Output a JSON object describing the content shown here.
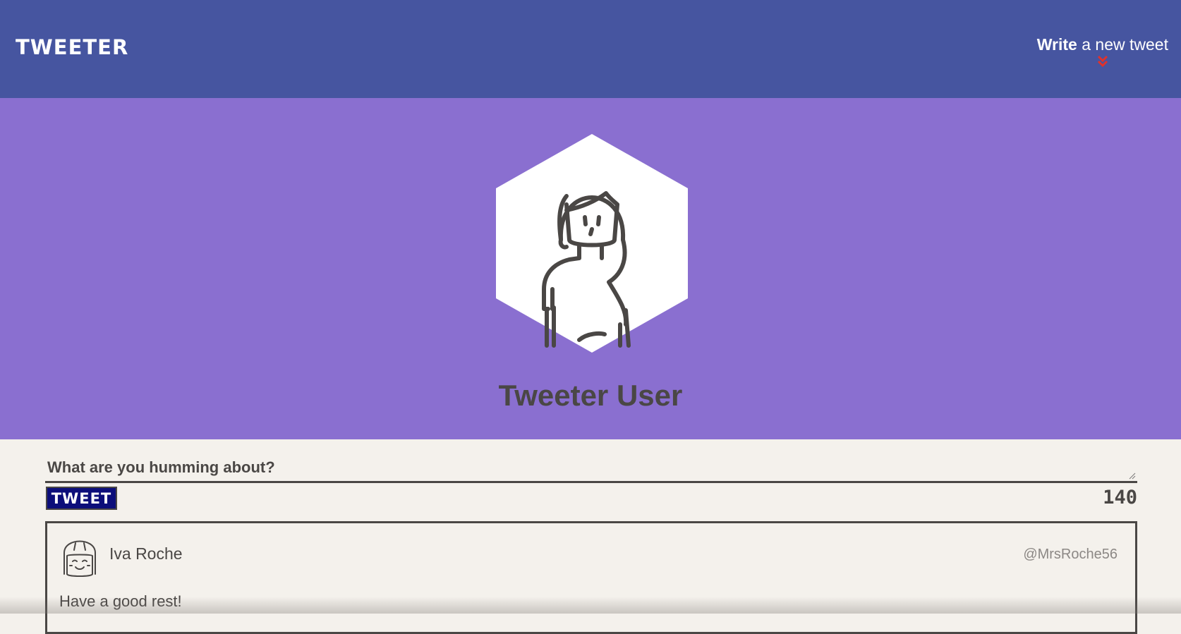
{
  "nav": {
    "brand": "TWEETER",
    "compose_prefix": "Write",
    "compose_suffix": " a new tweet",
    "compose_icon": "double-chevron-down-icon",
    "compose_icon_color": "#e0322b"
  },
  "profile": {
    "name": "Tweeter User",
    "avatar_icon": "woman-avatar-icon"
  },
  "composer": {
    "placeholder": "What are you humming about?",
    "submit_label": "TWEET",
    "char_count": "140"
  },
  "tweets": [
    {
      "author": "Iva Roche",
      "handle": "@MrsRoche56",
      "text": "Have a good rest!",
      "avatar_icon": "girl-avatar-icon"
    }
  ],
  "colors": {
    "nav_bg": "#4655a0",
    "hero_bg": "#8a6fd0",
    "page_bg": "#f4f1ec",
    "text": "#4a4745",
    "button_bg": "#0c0e7a"
  }
}
